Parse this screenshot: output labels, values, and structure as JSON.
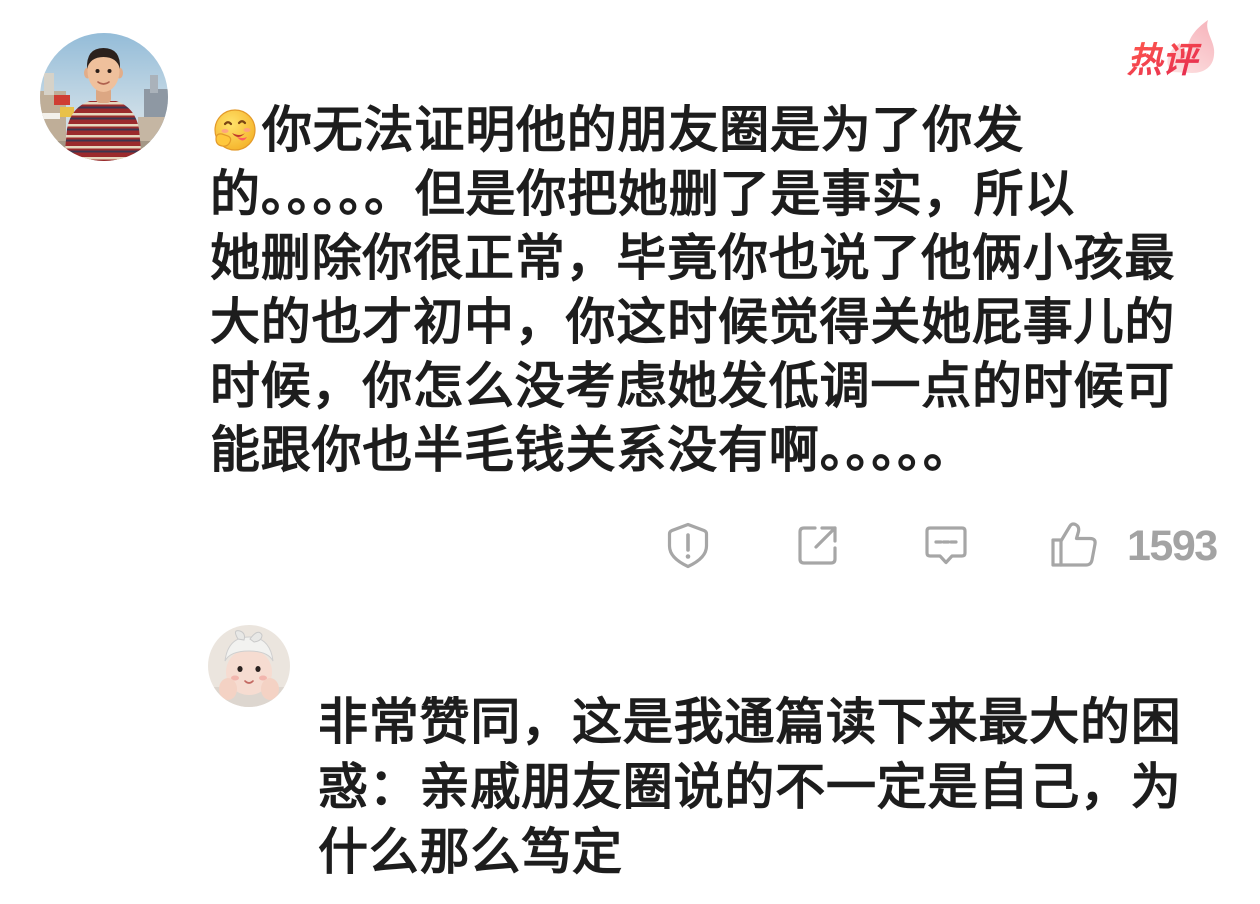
{
  "badge": {
    "label": "热评",
    "icon": "flame-icon"
  },
  "comment": {
    "avatar_icon": "user-avatar",
    "emoji_icon": "yummy-face-emoji",
    "lines": [
      "你无法证明他的朋友圈是为了你发",
      "的。。。。。但是你把她删了是事实，所以",
      "她删除你很正常，毕竟你也说了他俩小孩最",
      "大的也才初中，你这时候觉得关她屁事儿的",
      "时候，你怎么没考虑她发低调一点的时候可",
      "能跟你也半毛钱关系没有啊。。。。。"
    ]
  },
  "actions": {
    "report_icon": "report-icon",
    "share_icon": "share-icon",
    "reply_icon": "comment-icon",
    "like_icon": "thumbs-up-icon",
    "like_count": "1593"
  },
  "reply": {
    "avatar_icon": "user-avatar",
    "lines": [
      "非常赞同，这是我通篇读下来最大的困",
      "惑：亲戚朋友圈说的不一定是自己，为",
      "什么那么笃定"
    ]
  },
  "colors": {
    "background": "#ffffff",
    "text": "#1d1d1d",
    "muted": "#a3a3a3",
    "badge_red": "#e8344e",
    "badge_flame": "#f7b9c0"
  }
}
